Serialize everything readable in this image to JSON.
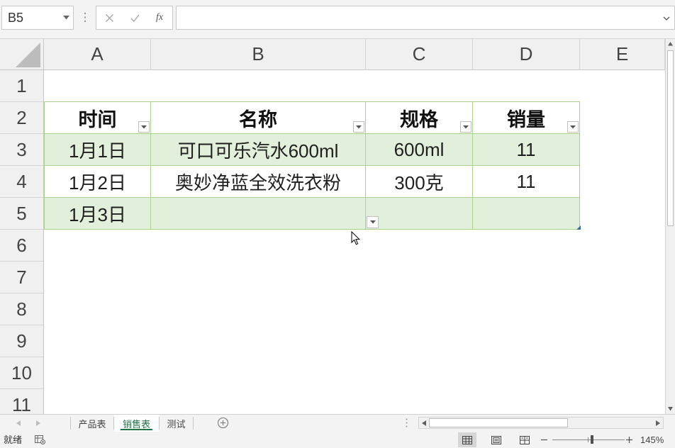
{
  "app": {
    "accent_color": "#217346"
  },
  "name_box": {
    "value": "B5",
    "dropdown_icon": "chevron-down-icon"
  },
  "formula_bar": {
    "grip_icon": "formula-bar-grip-icon",
    "cancel_icon": "close-icon",
    "enter_icon": "check-icon",
    "fx_label": "fx",
    "value": "",
    "expand_icon": "chevron-down-icon"
  },
  "grid": {
    "select_all_icon": "select-all-triangle-icon",
    "columns": [
      "A",
      "B",
      "C",
      "D",
      "E"
    ],
    "rows": [
      "1",
      "2",
      "3",
      "4",
      "5",
      "6",
      "7",
      "8",
      "9",
      "10",
      "11"
    ],
    "gridlines_visible": false,
    "header_bg": "#F0F0F0",
    "header_text_color": "#444444"
  },
  "table": {
    "headers": [
      "时间",
      "名称",
      "规格",
      "销量"
    ],
    "rows": [
      [
        "1月1日",
        "可口可乐汽水600ml",
        "600ml",
        "11"
      ],
      [
        "1月2日",
        "奥妙净蓝全效洗衣粉",
        "300克",
        "11"
      ],
      [
        "1月3日",
        "",
        "",
        ""
      ]
    ],
    "filter_icon": "filter-dropdown-icon",
    "banded_rows": true,
    "band_color": "#E2EFDA",
    "border_color": "#A9D08E"
  },
  "active_cell_dropdown_icon": "chevron-down-icon",
  "sheet_tabs": [
    {
      "label": "产品表",
      "active": false
    },
    {
      "label": "销售表",
      "active": true
    },
    {
      "label": "测试",
      "active": false
    }
  ],
  "sheet_nav": {
    "prev_icon": "triangle-left-icon",
    "next_icon": "triangle-right-icon",
    "add_sheet_icon": "add-circle-icon"
  },
  "status_bar": {
    "ready_text": "就绪",
    "macro_icon": "macro-record-icon",
    "views": [
      {
        "icon": "normal-view-icon",
        "active": true
      },
      {
        "icon": "page-layout-view-icon",
        "active": false
      },
      {
        "icon": "page-break-preview-icon",
        "active": false
      }
    ],
    "zoom_label": "145%"
  }
}
